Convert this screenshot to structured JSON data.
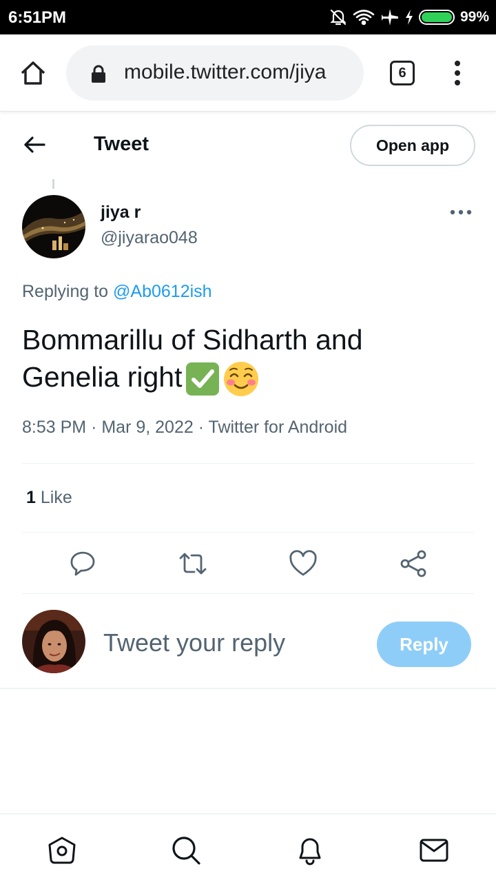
{
  "status_bar": {
    "time": "6:51PM",
    "battery_percent": "99%",
    "battery_level": 0.99,
    "icons": [
      "bell-off-icon",
      "wifi-icon",
      "airplane-icon",
      "charging-icon",
      "battery-icon"
    ]
  },
  "browser": {
    "url": "mobile.twitter.com/jiya",
    "tab_count": "6",
    "icons": [
      "home-icon",
      "lock-icon",
      "more-vertical-icon"
    ]
  },
  "header": {
    "title": "Tweet",
    "open_app_label": "Open app",
    "back_icon": "back-arrow-icon"
  },
  "tweet": {
    "author_name": "jiya r",
    "author_handle": "@jiyarao048",
    "replying_prefix": "Replying to",
    "replying_to": "@Ab0612ish",
    "text_line1": "Bommarillu of Sidharth and",
    "text_line2": "Genelia right",
    "emojis": [
      "check-mark-emoji",
      "smiling-blushing-emoji"
    ],
    "time": "8:53 PM",
    "date": "Mar 9, 2022",
    "source": "Twitter for Android",
    "separator": "·",
    "like_count": "1",
    "like_label": "Like"
  },
  "actions": [
    "reply-icon",
    "retweet-icon",
    "like-icon",
    "share-icon"
  ],
  "composer": {
    "placeholder": "Tweet your reply",
    "reply_label": "Reply"
  },
  "bottom_nav": [
    "home-icon",
    "search-icon",
    "notifications-icon",
    "messages-icon"
  ],
  "colors": {
    "accent": "#1d9bf0",
    "reply_button": "#8ecdf8",
    "secondary_text": "#536471",
    "battery": "#30d158"
  }
}
